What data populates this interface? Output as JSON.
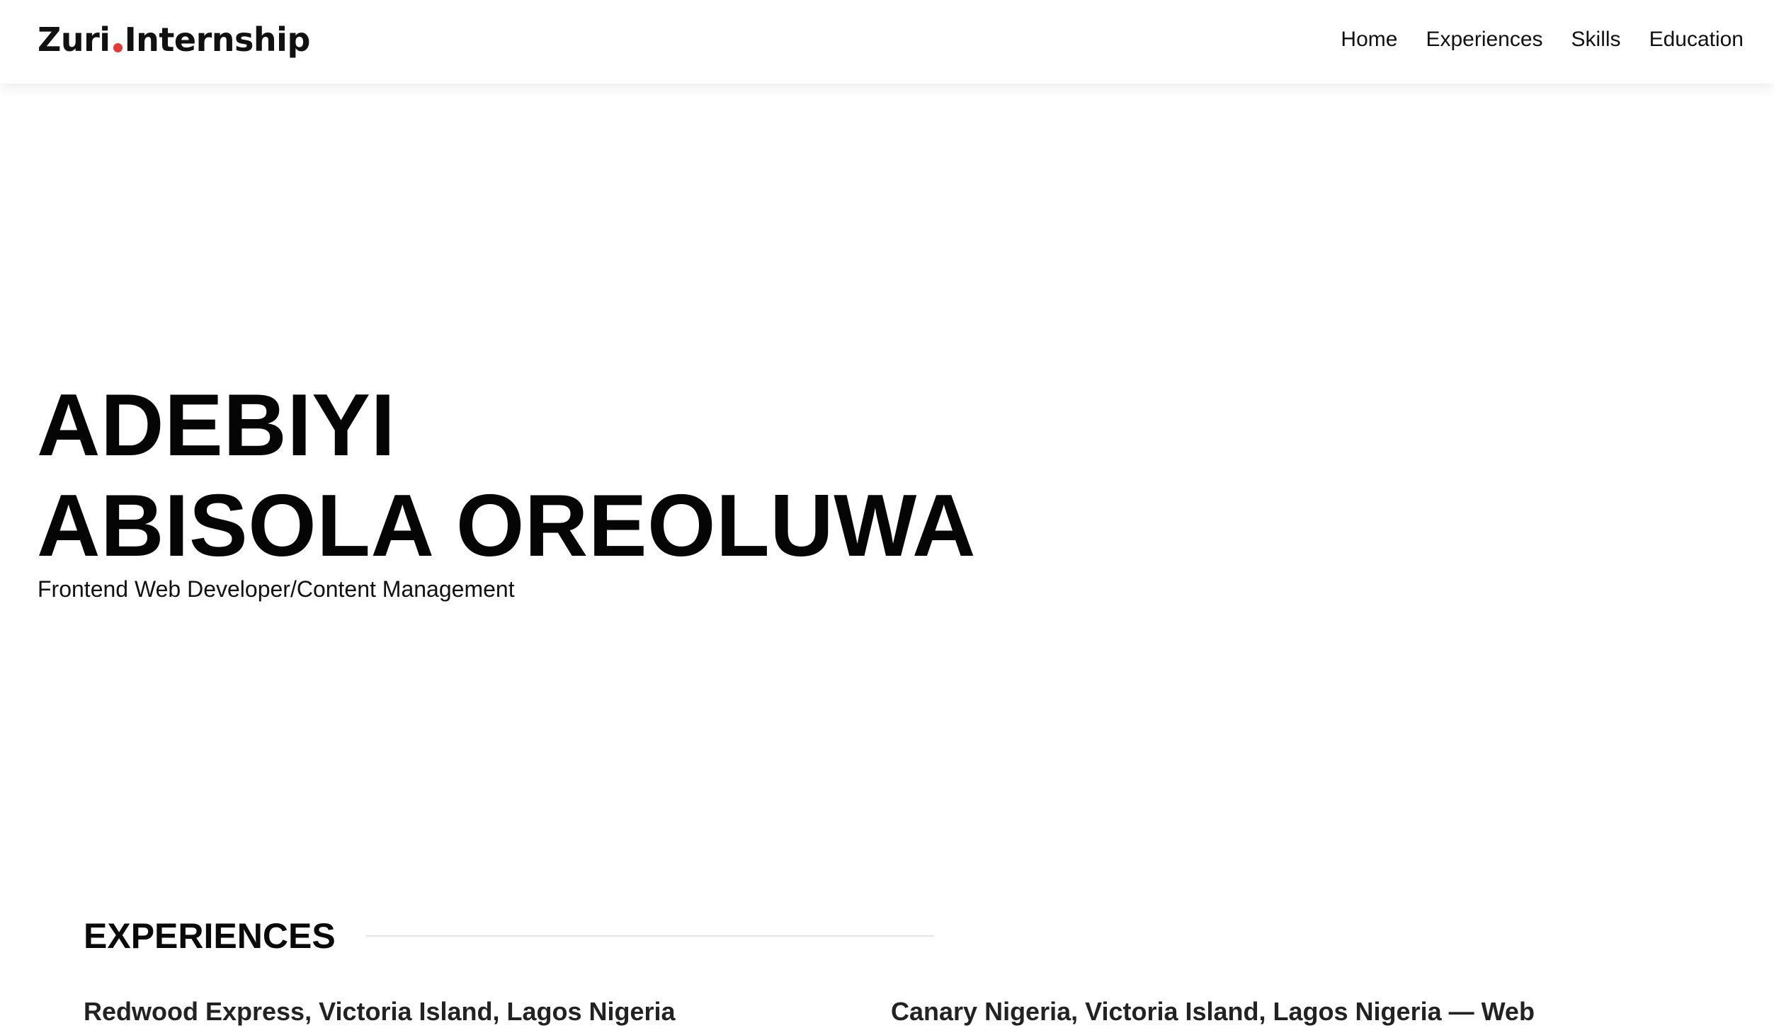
{
  "nav": {
    "logo_part1": "Zuri",
    "logo_part2": "Internship",
    "accent_color": "#e53935",
    "links": [
      "Home",
      "Experiences",
      "Skills",
      "Education"
    ]
  },
  "hero": {
    "name_line1": "ADEBIYI",
    "name_line2": "ABISOLA OREOLUWA",
    "subtitle": "Frontend Web Developer/Content Management"
  },
  "experiences": {
    "title": "EXPERIENCES",
    "items": [
      "Redwood Express, Victoria Island, Lagos Nigeria",
      "Canary Nigeria, Victoria Island, Lagos Nigeria — Web"
    ]
  }
}
